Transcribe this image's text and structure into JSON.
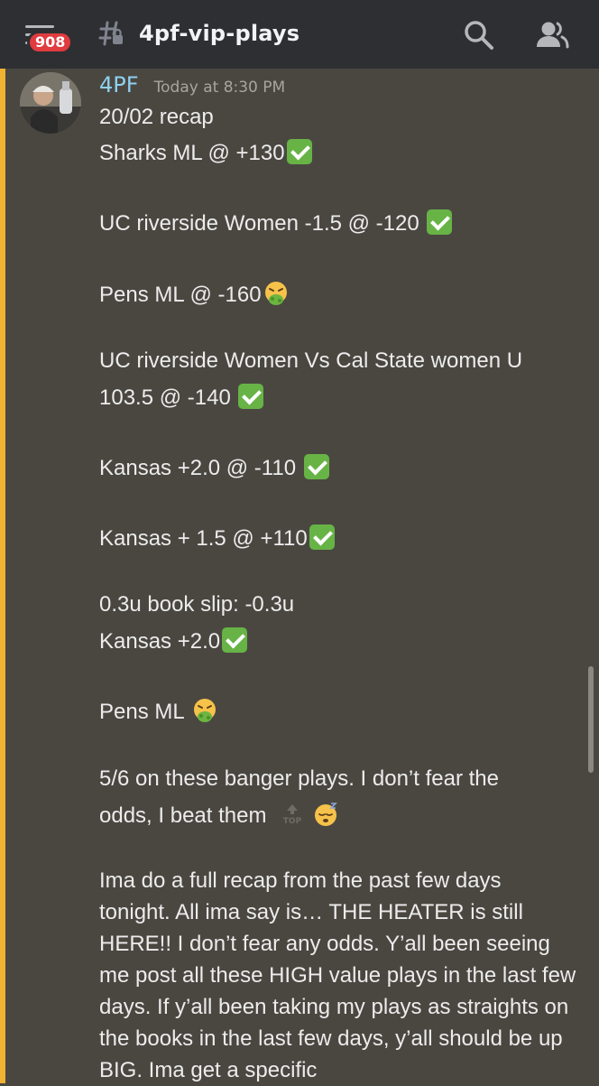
{
  "topbar": {
    "unread_count": "908",
    "channel_name": "4pf-vip-plays"
  },
  "message": {
    "author": "4PF",
    "timestamp": "Today at 8:30 PM",
    "lines": {
      "l1": "20/02 recap",
      "l2": "Sharks ML @ +130",
      "l3": "UC riverside Women -1.5 @ -120",
      "l4": "Pens ML @ -160",
      "l5": "UC riverside Women Vs Cal State women U",
      "l6": "103.5 @ -140",
      "l7": "Kansas +2.0 @ -110",
      "l8": "Kansas + 1.5 @ +110",
      "l9": "0.3u book slip: -0.3u",
      "l10": "Kansas +2.0",
      "l11": "Pens ML",
      "l12": "5/6 on these banger plays. I don’t fear the",
      "l13": "odds, I beat them"
    },
    "paragraph": "Ima do a full recap from the past few days tonight. All ima say is… THE HEATER is still HERE!! I don’t fear any odds. Y’all been seeing me post all these HIGH value plays in the last few days. If y’all been taking my plays as straights on the books in the last few days, y’all should be up BIG. Ima get a specific"
  },
  "icons": {
    "check": "white-check-mark-emoji",
    "sick": "nauseated-face-emoji",
    "top": "top-arrow-emoji",
    "sleep": "sleeping-face-emoji",
    "menu": "hamburger-menu-icon",
    "channel": "text-channel-hash-icon",
    "search": "search-icon",
    "members": "members-icon"
  },
  "colors": {
    "background": "#4a4741",
    "topbar": "#2d2f33",
    "accent": "#f0b232",
    "author": "#8fd0ef",
    "badge": "#e03b3f",
    "check": "#67b346"
  }
}
